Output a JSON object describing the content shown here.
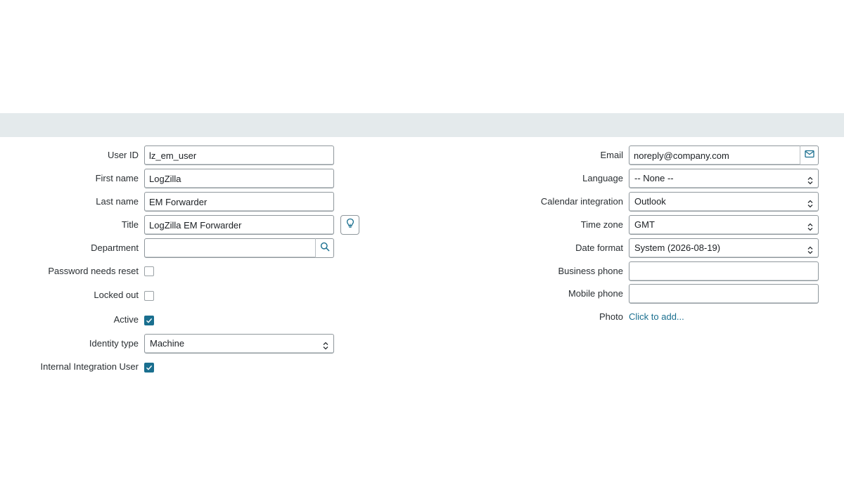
{
  "form": {
    "left": {
      "user_id": {
        "label": "User ID",
        "value": "lz_em_user"
      },
      "first_name": {
        "label": "First name",
        "value": "LogZilla"
      },
      "last_name": {
        "label": "Last name",
        "value": "EM Forwarder"
      },
      "title": {
        "label": "Title",
        "value": "LogZilla EM Forwarder"
      },
      "department": {
        "label": "Department",
        "value": ""
      },
      "password_needs_reset": {
        "label": "Password needs reset",
        "checked": false
      },
      "locked_out": {
        "label": "Locked out",
        "checked": false
      },
      "active": {
        "label": "Active",
        "checked": true
      },
      "identity_type": {
        "label": "Identity type",
        "value": "Machine"
      },
      "internal_integration_user": {
        "label": "Internal Integration User",
        "checked": true
      }
    },
    "right": {
      "email": {
        "label": "Email",
        "value": "noreply@company.com"
      },
      "language": {
        "label": "Language",
        "value": "-- None --"
      },
      "calendar_integration": {
        "label": "Calendar integration",
        "value": "Outlook"
      },
      "time_zone": {
        "label": "Time zone",
        "value": "GMT"
      },
      "date_format": {
        "label": "Date format",
        "value": "System (2026-08-19)"
      },
      "business_phone": {
        "label": "Business phone",
        "value": ""
      },
      "mobile_phone": {
        "label": "Mobile phone",
        "value": ""
      },
      "photo": {
        "label": "Photo",
        "link": "Click to add..."
      }
    }
  },
  "icons": {
    "email": "envelope-icon",
    "title_suggest": "lightbulb-icon",
    "department_lookup": "search-icon",
    "select": "chevron-up-down-icon",
    "checkbox": "checkmark-icon"
  },
  "colors": {
    "accent": "#1a6f8f",
    "header_band": "#e4eaec",
    "field_border": "#8f979c"
  }
}
